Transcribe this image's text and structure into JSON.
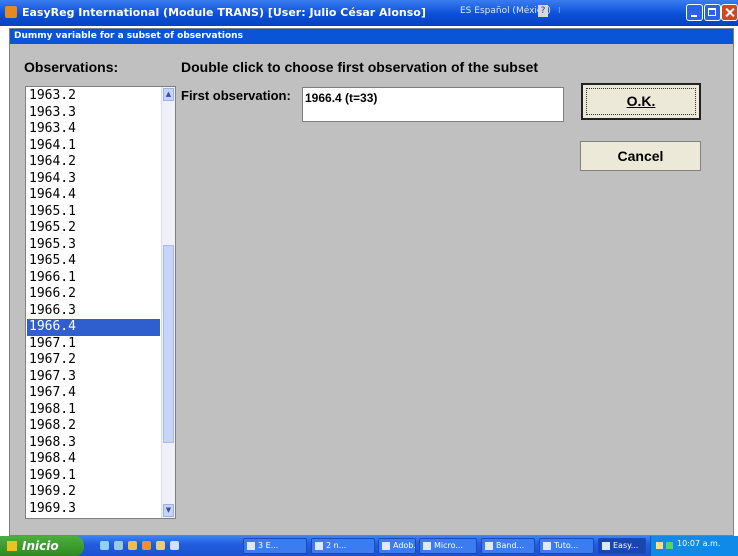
{
  "window": {
    "title": "EasyReg International (Module TRANS) [User: Julio César Alonso]",
    "language": "ES Español (México)",
    "help_glyph": "?",
    "lang_arrow": "⁝"
  },
  "dialog": {
    "title": "Dummy variable for a subset of observations",
    "observations_label": "Observations:",
    "instruction": "Double click to choose first observation of the subset",
    "first_observation_label": "First observation:",
    "first_observation_value": "1966.4 (t=33)",
    "ok_label": "O.K.",
    "cancel_label": "Cancel"
  },
  "observations": {
    "items": [
      "1963.2",
      "1963.3",
      "1963.4",
      "1964.1",
      "1964.2",
      "1964.3",
      "1964.4",
      "1965.1",
      "1965.2",
      "1965.3",
      "1965.4",
      "1966.1",
      "1966.2",
      "1966.3",
      "1966.4",
      "1967.1",
      "1967.2",
      "1967.3",
      "1967.4",
      "1968.1",
      "1968.2",
      "1968.3",
      "1968.4",
      "1969.1",
      "1969.2",
      "1969.3"
    ],
    "selected_index": 14,
    "scroll_up_glyph": "▲",
    "scroll_down_glyph": "▼"
  },
  "taskbar": {
    "start_label": "Inicio",
    "tasks": [
      {
        "label": "3 E...",
        "icon": "folder-icon"
      },
      {
        "label": "2 n...",
        "icon": "window-icon"
      },
      {
        "label": "Adob...",
        "icon": "adobe-icon"
      },
      {
        "label": "Micro...",
        "icon": "word-icon"
      },
      {
        "label": "Band...",
        "icon": "folder-icon"
      },
      {
        "label": "Tuto...",
        "icon": "document-icon"
      },
      {
        "label": "Easy...",
        "icon": "app-icon"
      }
    ],
    "clock": "10:07 a.m."
  }
}
